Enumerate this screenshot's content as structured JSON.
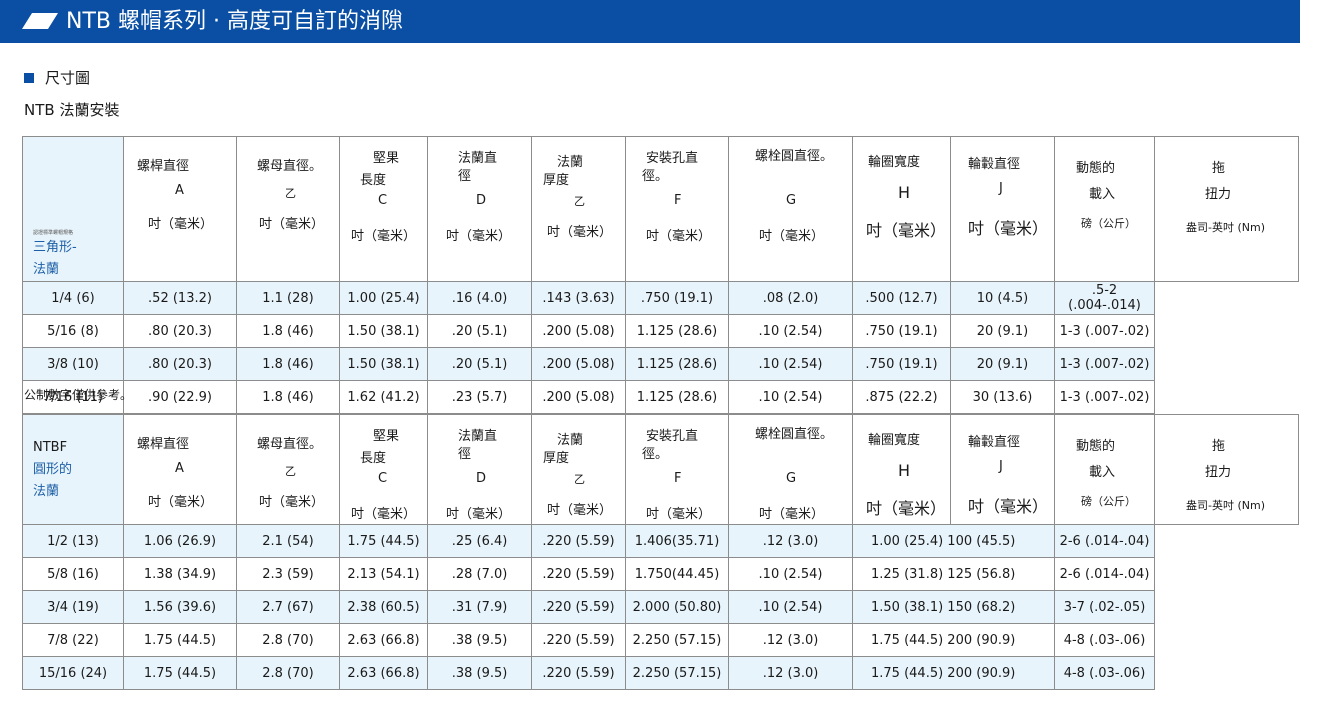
{
  "header": {
    "title": "NTB 螺帽系列 · 高度可自訂的消隙"
  },
  "section": {
    "title": "尺寸圖"
  },
  "subtitle": "NTB 法蘭安裝",
  "note": "公制數字僅供參考。",
  "columns": [
    {
      "l1": "螺桿直徑",
      "l2": "A",
      "l3": "吋（毫米）"
    },
    {
      "l1": "螺母直徑。",
      "l2": "乙",
      "l3": "吋（毫米）"
    },
    {
      "l1": "堅果",
      "l1b": "長度",
      "l2": "C",
      "l3": "吋（毫米）"
    },
    {
      "l1": "法蘭直",
      "l1b": "徑",
      "l2": "D",
      "l3": "吋（毫米）"
    },
    {
      "l1": "法蘭",
      "l1b": "厚度",
      "l2": "乙",
      "l3": "吋（毫米）"
    },
    {
      "l1": "安裝孔直",
      "l1b": "徑。",
      "l2": "F",
      "l3": "吋（毫米）"
    },
    {
      "l1": "螺栓圓直徑。",
      "l2": "G",
      "l3": "吋（毫米）"
    },
    {
      "l1": "輪圈寬度",
      "l2": "H",
      "l3": "吋（毫米）"
    },
    {
      "l1": "輪轂直徑",
      "l2": "J",
      "l3": "吋（毫米）"
    },
    {
      "l1": "動態的",
      "l2": "載入",
      "l3": "磅（公斤）"
    },
    {
      "l1": "拖",
      "l2": "扭力",
      "l3": "盎司-英吋 (Nm)"
    }
  ],
  "table1": {
    "type_small": "認證標準螺帽規格",
    "type_line1": "三角形-",
    "type_line2": "法蘭",
    "rows": [
      [
        "1/4 (6)",
        ".52 (13.2)",
        "1.1 (28)",
        "1.00 (25.4)",
        ".16 (4.0)",
        ".143 (3.63)",
        ".750 (19.1)",
        ".08 (2.0)",
        ".500 (12.7)",
        "10 (4.5)",
        ".5-2 (.004-.014)"
      ],
      [
        "5/16 (8)",
        ".80 (20.3)",
        "1.8 (46)",
        "1.50 (38.1)",
        ".20 (5.1)",
        ".200 (5.08)",
        "1.125 (28.6)",
        ".10 (2.54)",
        ".750 (19.1)",
        "20 (9.1)",
        "1-3 (.007-.02)"
      ],
      [
        "3/8 (10)",
        ".80 (20.3)",
        "1.8 (46)",
        "1.50 (38.1)",
        ".20 (5.1)",
        ".200 (5.08)",
        "1.125 (28.6)",
        ".10 (2.54)",
        ".750 (19.1)",
        "20 (9.1)",
        "1-3 (.007-.02)"
      ],
      [
        "7/16 (11)",
        ".90 (22.9)",
        "1.8 (46)",
        "1.62 (41.2)",
        ".23 (5.7)",
        ".200 (5.08)",
        "1.125 (28.6)",
        ".10 (2.54)",
        ".875 (22.2)",
        "30 (13.6)",
        "1-3 (.007-.02)"
      ]
    ]
  },
  "table2": {
    "type_line0": "NTBF",
    "type_line1": "圓形的",
    "type_line2": "法蘭",
    "rows": [
      [
        "1/2 (13)",
        "1.06 (26.9)",
        "2.1 (54)",
        "1.75 (44.5)",
        ".25 (6.4)",
        ".220 (5.59)",
        "1.406(35.71)",
        ".12 (3.0)",
        "1.00 (25.4) 100 (45.5)",
        "",
        "2-6 (.014-.04)"
      ],
      [
        "5/8 (16)",
        "1.38 (34.9)",
        "2.3 (59)",
        "2.13 (54.1)",
        ".28 (7.0)",
        ".220 (5.59)",
        "1.750(44.45)",
        ".10 (2.54)",
        "1.25 (31.8) 125 (56.8)",
        "",
        "2-6 (.014-.04)"
      ],
      [
        "3/4 (19)",
        "1.56 (39.6)",
        "2.7 (67)",
        "2.38 (60.5)",
        ".31 (7.9)",
        ".220 (5.59)",
        "2.000 (50.80)",
        ".10 (2.54)",
        "1.50 (38.1) 150 (68.2)",
        "",
        "3-7 (.02-.05)"
      ],
      [
        "7/8 (22)",
        "1.75 (44.5)",
        "2.8 (70)",
        "2.63 (66.8)",
        ".38 (9.5)",
        ".220 (5.59)",
        "2.250 (57.15)",
        ".12 (3.0)",
        "1.75 (44.5) 200 (90.9)",
        "",
        "4-8 (.03-.06)"
      ],
      [
        "15/16 (24)",
        "1.75 (44.5)",
        "2.8 (70)",
        "2.63 (66.8)",
        ".38 (9.5)",
        ".220 (5.59)",
        "2.250 (57.15)",
        ".12 (3.0)",
        "1.75 (44.5) 200 (90.9)",
        "",
        "4-8 (.03-.06)"
      ]
    ]
  }
}
